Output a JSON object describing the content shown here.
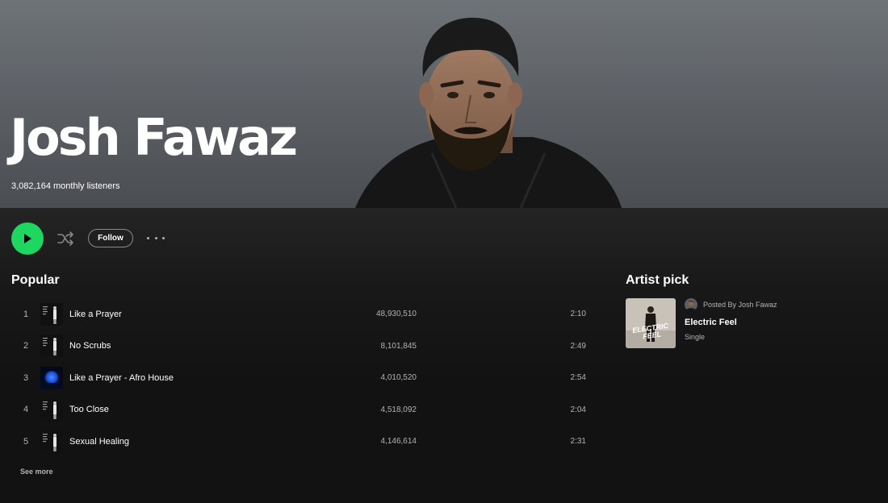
{
  "artist": {
    "name": "Josh Fawaz",
    "monthly_listeners": "3,082,164 monthly listeners"
  },
  "actions": {
    "follow_label": "Follow"
  },
  "popular": {
    "title": "Popular",
    "see_more": "See more",
    "tracks": [
      {
        "num": "1",
        "title": "Like a Prayer",
        "plays": "48,930,510",
        "duration": "2:10",
        "cover": "dark-single"
      },
      {
        "num": "2",
        "title": "No Scrubs",
        "plays": "8,101,845",
        "duration": "2:49",
        "cover": "dark-single"
      },
      {
        "num": "3",
        "title": "Like a Prayer - Afro House",
        "plays": "4,010,520",
        "duration": "2:54",
        "cover": "blue-orb"
      },
      {
        "num": "4",
        "title": "Too Close",
        "plays": "4,518,092",
        "duration": "2:04",
        "cover": "dark-single"
      },
      {
        "num": "5",
        "title": "Sexual Healing",
        "plays": "4,146,614",
        "duration": "2:31",
        "cover": "dark-single"
      }
    ]
  },
  "artist_pick": {
    "title": "Artist pick",
    "posted_by": "Posted By Josh Fawaz",
    "release_name": "Electric Feel",
    "release_type": "Single",
    "cover_text": "ELECTRIC FEEL"
  },
  "colors": {
    "accent_green": "#1ed760",
    "background": "#121212",
    "secondary_text": "#b3b3b3"
  },
  "icons": {
    "play": "play-icon",
    "shuffle": "shuffle-icon",
    "more": "more-options-icon"
  }
}
